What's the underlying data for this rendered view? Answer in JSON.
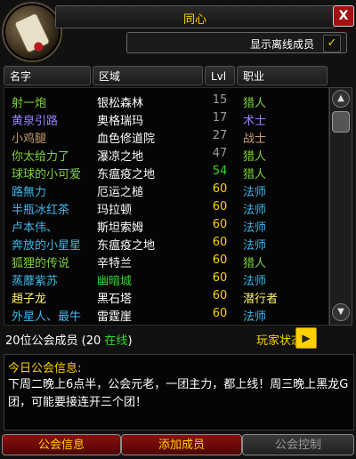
{
  "window": {
    "title": "同心",
    "close_label": "X"
  },
  "offline": {
    "label": "显示离线成员",
    "check": "✓"
  },
  "columns": {
    "name": "名字",
    "zone": "区域",
    "level": "Lvl",
    "class": "职业"
  },
  "members": [
    {
      "name": "射一炮",
      "zone": "银松森林",
      "level": "15",
      "class": "猎人",
      "name_color": "#7fd13b",
      "level_color": "#9d9d9d",
      "class_color": "#7fd13b"
    },
    {
      "name": "黄泉引路",
      "zone": "奥格瑞玛",
      "level": "17",
      "class": "术士",
      "name_color": "#9482ff",
      "level_color": "#9d9d9d",
      "class_color": "#9482ff"
    },
    {
      "name": "小鸡腿",
      "zone": "血色修道院",
      "level": "27",
      "class": "战士",
      "name_color": "#c79c6e",
      "level_color": "#9d9d9d",
      "class_color": "#c79c6e"
    },
    {
      "name": "你太给力了",
      "zone": "瀑凉之地",
      "level": "47",
      "class": "猎人",
      "name_color": "#7fd13b",
      "level_color": "#9d9d9d",
      "class_color": "#7fd13b"
    },
    {
      "name": "球球的小可爱",
      "zone": "东瘟疫之地",
      "level": "54",
      "class": "猎人",
      "name_color": "#7fd13b",
      "level_color": "#2fd82f",
      "class_color": "#7fd13b"
    },
    {
      "name": "路無力",
      "zone": "厄运之槌",
      "level": "60",
      "class": "法师",
      "name_color": "#3fb7e8",
      "level_color": "#ffd100",
      "class_color": "#3fb7e8"
    },
    {
      "name": "半瓶冰红茶",
      "zone": "玛拉顿",
      "level": "60",
      "class": "法师",
      "name_color": "#3fb7e8",
      "level_color": "#ffd100",
      "class_color": "#3fb7e8"
    },
    {
      "name": "卢本伟、",
      "zone": "斯坦索姆",
      "level": "60",
      "class": "法师",
      "name_color": "#3fb7e8",
      "level_color": "#ffd100",
      "class_color": "#3fb7e8"
    },
    {
      "name": "奔放的小星星",
      "zone": "东瘟疫之地",
      "level": "60",
      "class": "法师",
      "name_color": "#3fb7e8",
      "level_color": "#ffd100",
      "class_color": "#3fb7e8"
    },
    {
      "name": "狐狸的传说",
      "zone": "辛特兰",
      "level": "60",
      "class": "猎人",
      "name_color": "#7fd13b",
      "level_color": "#ffd100",
      "class_color": "#7fd13b"
    },
    {
      "name": "蒸蘼紫苏",
      "zone": "幽暗城",
      "level": "60",
      "class": "法师",
      "name_color": "#3fb7e8",
      "level_color": "#ffd100",
      "class_color": "#3fb7e8",
      "zone_color": "#2fd82f"
    },
    {
      "name": "趙子龙",
      "zone": "黑石塔",
      "level": "60",
      "class": "潜行者",
      "name_color": "#fff569",
      "level_color": "#ffd100",
      "class_color": "#fff569"
    },
    {
      "name": "外星人、最牛",
      "zone": "雷霆崖",
      "level": "60",
      "class": "法师",
      "name_color": "#3fb7e8",
      "level_color": "#ffd100",
      "class_color": "#3fb7e8"
    }
  ],
  "footer": {
    "count_prefix": "20位公会成员 (20 ",
    "count_online": "在线",
    "count_suffix": ")",
    "player_state": "玩家状态",
    "player_state_btn": "▶"
  },
  "motd": {
    "title": "今日公会信息:",
    "text": "下周二晚上6点半，公会元老，一团主力，都上线！周三晚上黑龙G团，可能要接连开三个团！"
  },
  "buttons": {
    "guild_info": "公会信息",
    "add_member": "添加成员",
    "guild_control": "公会控制"
  },
  "scrollbar": {
    "up": "▲",
    "down": "▼"
  },
  "colors": {
    "accent": "#ffd100",
    "online": "#2fd82f",
    "zone_text": "#ffffff"
  }
}
